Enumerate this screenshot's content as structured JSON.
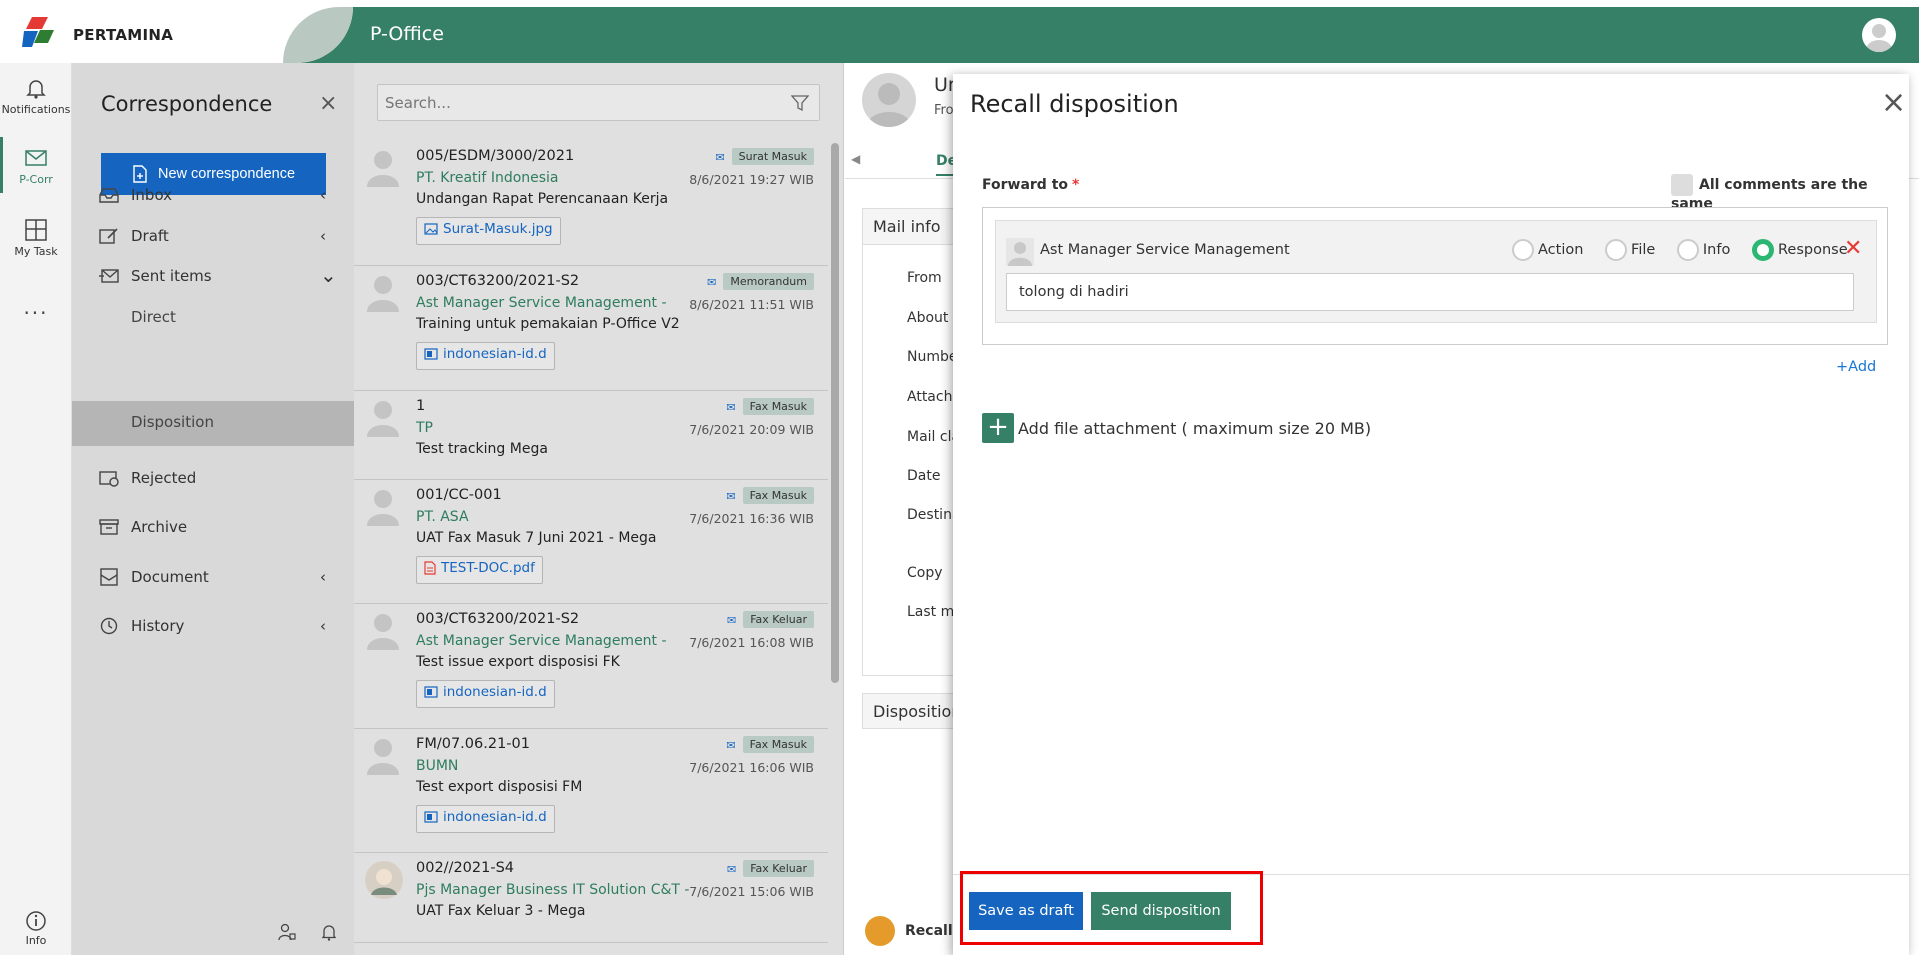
{
  "header": {
    "logo_text": "PERTAMINA",
    "app_title": "P-Office"
  },
  "leftnav": [
    {
      "label": "Notifications",
      "icon": "bell-icon"
    },
    {
      "label": "P-Corr",
      "icon": "mail-icon"
    },
    {
      "label": "My Task",
      "icon": "grid-icon"
    }
  ],
  "leftnav_more": "...",
  "leftnav_info": "Info",
  "sidebar": {
    "title": "Correspondence",
    "close": "×",
    "new_button": "New correspondence",
    "items": [
      {
        "label": "Inbox",
        "chevron": "‹"
      },
      {
        "label": "Draft",
        "chevron": "‹"
      },
      {
        "label": "Sent items",
        "chevron": "⌄"
      },
      {
        "label": "Direct"
      },
      {
        "label": "Disposition"
      },
      {
        "label": "Rejected"
      },
      {
        "label": "Archive"
      },
      {
        "label": "Document",
        "chevron": "‹"
      },
      {
        "label": "History",
        "chevron": "‹"
      }
    ]
  },
  "search": {
    "placeholder": "Search..."
  },
  "mails": [
    {
      "number": "005/ESDM/3000/2021",
      "sender": "PT. Kreatif Indonesia",
      "subject": "Undangan Rapat Perencanaan Kerja",
      "badge": "Surat Masuk",
      "date": "8/6/2021 19:27 WIB",
      "attachment": "Surat-Masuk.jpg"
    },
    {
      "number": "003/CT63200/2021-S2",
      "sender": "Ast Manager Service Management -",
      "subject": "Training untuk pemakaian P-Office V2",
      "badge": "Memorandum",
      "date": "8/6/2021 11:51 WIB",
      "attachment": "indonesian-id.d"
    },
    {
      "number": "1",
      "sender": "TP",
      "subject": "Test tracking Mega",
      "badge": "Fax Masuk",
      "date": "7/6/2021 20:09 WIB",
      "attachment": ""
    },
    {
      "number": "001/CC-001",
      "sender": "PT. ASA",
      "subject": "UAT Fax Masuk 7 Juni 2021 - Mega",
      "badge": "Fax Masuk",
      "date": "7/6/2021 16:36 WIB",
      "attachment": "TEST-DOC.pdf"
    },
    {
      "number": "003/CT63200/2021-S2",
      "sender": "Ast Manager Service Management -",
      "subject": "Test issue export disposisi FK",
      "badge": "Fax Keluar",
      "date": "7/6/2021 16:08 WIB",
      "attachment": "indonesian-id.d"
    },
    {
      "number": "FM/07.06.21-01",
      "sender": "BUMN",
      "subject": "Test export disposisi FM",
      "badge": "Fax Masuk",
      "date": "7/6/2021 16:06 WIB",
      "attachment": "indonesian-id.d"
    },
    {
      "number": "002//2021-S4",
      "sender": "Pjs Manager Business IT Solution C&T -",
      "subject": "UAT Fax Keluar 3 - Mega",
      "badge": "Fax Keluar",
      "date": "7/6/2021 15:06 WIB",
      "attachment": ""
    }
  ],
  "detail": {
    "header_line1": "Ur",
    "header_line2": "Fro",
    "tab": "De",
    "mailinfo_title": "Mail info",
    "rows": [
      "From",
      "About",
      "Number",
      "Attachm",
      "Mail cla",
      "Date",
      "Destina",
      "Copy",
      "Last mo"
    ],
    "disposition_title": "Disposition",
    "recall_label": "Recall c"
  },
  "modal": {
    "title": "Recall disposition",
    "close": "×",
    "forward_label": "Forward to",
    "required_mark": "*",
    "all_comments": "All comments are the same",
    "person": "Ast Manager Service Management",
    "radios": [
      "Action",
      "File",
      "Info",
      "Response"
    ],
    "selected_radio": "Response",
    "remove": "✕",
    "comment_value": "tolong di hadiri",
    "add_link": "+Add",
    "attach_label": "Add file attachment ( maximum size 20 MB)",
    "save_draft": "Save as draft",
    "send": "Send disposition"
  },
  "colors": {
    "brand_green": "#358066",
    "primary_blue": "#1565c0",
    "danger": "#e53935",
    "highlight": "#e00000"
  }
}
